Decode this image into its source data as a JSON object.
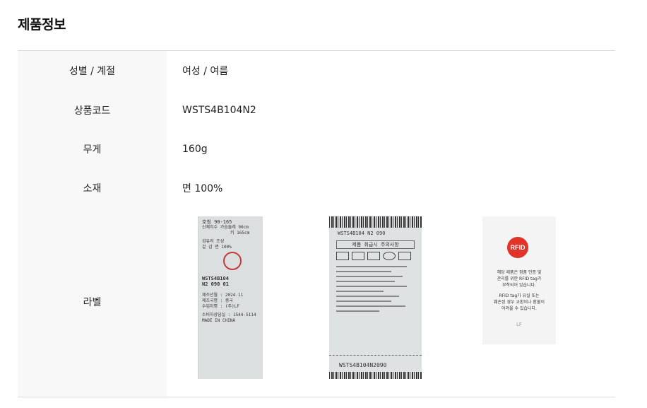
{
  "section_title": "제품정보",
  "rows": [
    {
      "label": "성별 / 계절",
      "value": "여성 / 여름"
    },
    {
      "label": "상품코드",
      "value": "WSTS4B104N2"
    },
    {
      "label": "무게",
      "value": "160g"
    },
    {
      "label": "소재",
      "value": "면 100%"
    },
    {
      "label": "라벨",
      "value": ""
    }
  ],
  "care_label": {
    "size_header": "호칭   90-165",
    "size_line1": "신체치수 가슴둘레  90cm",
    "size_line2": "키  165cm",
    "material_header": "섬유의 조성",
    "material_line": "겉 감   면   100%",
    "code_line1": "WSTS4B104",
    "code_line2": "N2 090 01",
    "date_line": "제조년월 : 2024.11",
    "country_line": "제조국명 : 중국",
    "importer_line": "수입자명 : (주)LF",
    "phone_line": "소비자상담실 : 1544-5114",
    "made_in": "MADE IN CHINA"
  },
  "wash_label": {
    "code_top": "WSTS4B104 N2 090",
    "header": "제품 취급시 주의사항",
    "code_bottom": "WSTS4B104N2090"
  },
  "rfid_label": {
    "badge_text": "RFID",
    "text_line1": "해당 제품은 정품 인증 및",
    "text_line2": "관리를 위한 RFID tag가",
    "text_line3": "부착되어 있습니다.",
    "text_line4": "RFID tag가 유실 또는",
    "text_line5": "훼손된 경우 교환이나 환불이",
    "text_line6": "어려울 수 있습니다.",
    "brand": "LF"
  },
  "colors": {
    "header_bg": "#f8f8f8",
    "border": "#dcdcdc",
    "rfid_red": "#e2332b"
  }
}
